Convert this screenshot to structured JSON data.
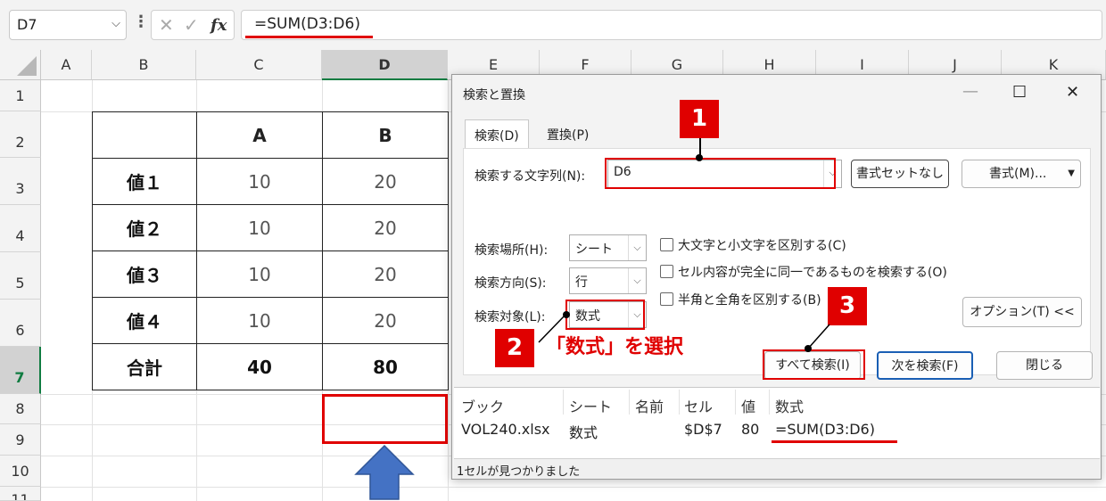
{
  "formula_bar": {
    "name_box": "D7",
    "cancel_glyph": "✕",
    "confirm_glyph": "✓",
    "fx_label": "fx",
    "formula": "=SUM(D3:D6)"
  },
  "sheet": {
    "columns": [
      "A",
      "B",
      "C",
      "D",
      "E",
      "F",
      "G",
      "H",
      "I",
      "J",
      "K"
    ],
    "rows": [
      "1",
      "2",
      "3",
      "4",
      "5",
      "6",
      "7",
      "8",
      "9",
      "10",
      "11"
    ],
    "selected_column": "D",
    "selected_row": "7",
    "table": {
      "header": [
        "",
        "A",
        "B"
      ],
      "body": [
        [
          "値１",
          "10",
          "20"
        ],
        [
          "値２",
          "10",
          "20"
        ],
        [
          "値３",
          "10",
          "20"
        ],
        [
          "値４",
          "10",
          "20"
        ]
      ],
      "total": [
        "合計",
        "40",
        "80"
      ]
    }
  },
  "dialog": {
    "title": "検索と置換",
    "tabs": [
      {
        "label": "検索(D)"
      },
      {
        "label": "置換(P)"
      }
    ],
    "search_label": "検索する文字列(N):",
    "search_value": "D6",
    "no_format_button": "書式セットなし",
    "format_button": "書式(M)...",
    "within_label": "検索場所(H):",
    "within_value": "シート",
    "search_dir_label": "検索方向(S):",
    "search_dir_value": "行",
    "look_in_label": "検索対象(L):",
    "look_in_value": "数式",
    "options": [
      "大文字と小文字を区別する(C)",
      "セル内容が完全に同一であるものを検索する(O)",
      "半角と全角を区別する(B)"
    ],
    "options_button": "オプション(T) <<",
    "find_all_button": "すべて検索(I)",
    "find_next_button": "次を検索(F)",
    "close_button": "閉じる",
    "results": {
      "headers": [
        "ブック",
        "シート",
        "名前",
        "セル",
        "値",
        "数式"
      ],
      "row": [
        "VOL240.xlsx",
        "数式",
        "",
        "$D$7",
        "80",
        "=SUM(D3:D6)"
      ]
    },
    "status": "1セルが見つかりました"
  },
  "annotations": {
    "badge_1": "1",
    "badge_2": "2",
    "badge_3": "3",
    "callout_2": "「数式」を選択",
    "accent_color": "#e00000",
    "arrow_color": "#4472c4"
  }
}
